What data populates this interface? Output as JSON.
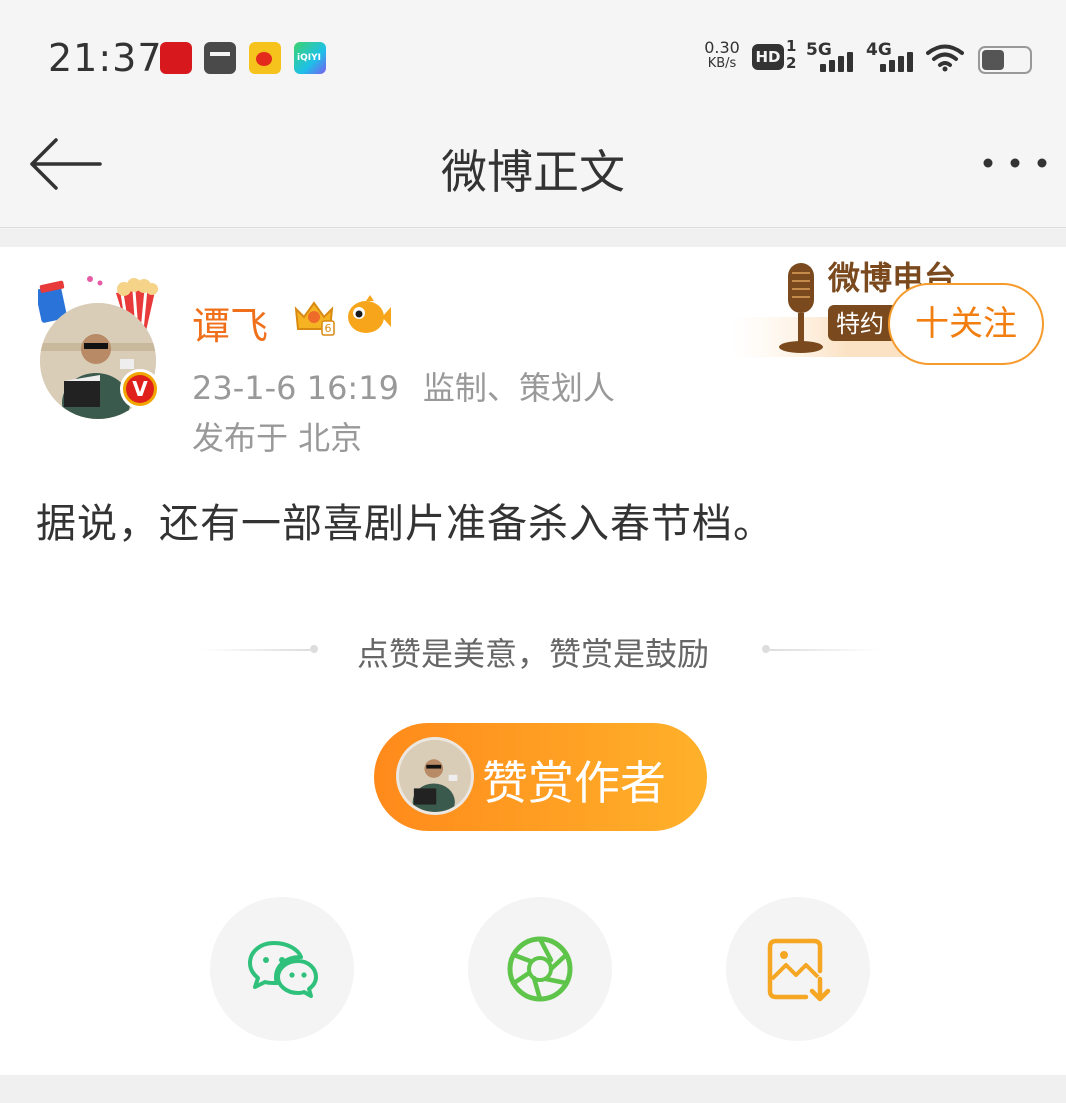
{
  "status_bar": {
    "time": "21:37",
    "net_speed_value": "0.30",
    "net_speed_unit": "KB/s",
    "hd_label": "HD",
    "hd_sub_1": "1",
    "hd_sub_2": "2",
    "sig1_label": "5G",
    "sig2_label": "4G",
    "notif_4_text": "iQIYI"
  },
  "nav": {
    "title": "微博正文"
  },
  "post": {
    "author": "谭飞",
    "verify_mark": "V",
    "crown_level": "6",
    "time": "23-1-6 16:19",
    "source": "监制、策划人",
    "location": "发布于 北京",
    "text": "据说，还有一部喜剧片准备杀入春节档。",
    "follow_label": "十关注",
    "banner_title": "微博电台",
    "banner_sub": "特约"
  },
  "reward": {
    "caption": "点赞是美意，赞赏是鼓励",
    "button_label": "赞赏作者"
  },
  "colors": {
    "accent_orange": "#f06f1b",
    "wechat_green": "#2fc17b",
    "moments_green": "#5fc54a",
    "save_orange": "#f5a623"
  }
}
